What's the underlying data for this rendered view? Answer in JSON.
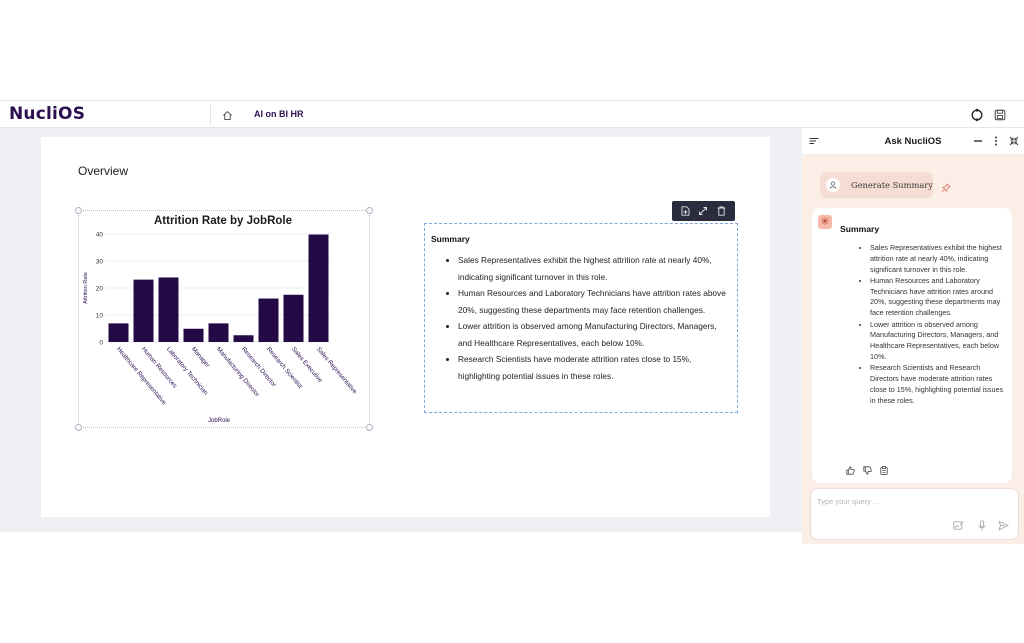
{
  "app": {
    "logo": "NucliOS",
    "breadcrumb": "AI on BI HR"
  },
  "colors": {
    "brand": "#2b0f4f",
    "bar": "#240a45",
    "panel_bg": "#fbeee7",
    "selection": "#7fa9dc"
  },
  "icons": {
    "home": "home-icon",
    "sync": "refresh-icon",
    "save": "save-icon"
  },
  "overview": {
    "title": "Overview"
  },
  "chart_data": {
    "type": "bar",
    "title": "Attrition Rate by JobRole",
    "xlabel": "JobRole",
    "ylabel": "Attrition Rate",
    "ylim": [
      0,
      40
    ],
    "yticks": [
      0,
      10,
      20,
      30,
      40
    ],
    "grid": true,
    "categories": [
      "Healthcare Representative",
      "Human Resources",
      "Laboratory Technician",
      "Manager",
      "Manufacturing Director",
      "Research Director",
      "Research Scientist",
      "Sales Executive",
      "Sales Representative"
    ],
    "values": [
      6.9,
      23.1,
      23.9,
      4.9,
      6.9,
      2.5,
      16.1,
      17.5,
      39.8
    ]
  },
  "summary_card": {
    "title": "Summary",
    "bullets": [
      "Sales Representatives exhibit the highest attrition rate at nearly 40%, indicating significant turnover in this role.",
      "Human Resources and Laboratory Technicians have attrition rates above 20%, suggesting these departments may face retention challenges.",
      "Lower attrition is observed among Manufacturing Directors, Managers, and Healthcare Representatives, each below 10%.",
      "Research Scientists have moderate attrition rates close to 15%, highlighting potential issues in these roles."
    ]
  },
  "ask_panel": {
    "title": "Ask NucliOS",
    "generate_button": "Generate Summary",
    "message": {
      "title": "Summary",
      "bullets": [
        "Sales Representatives exhibit the highest attrition rate at nearly 40%, indicating significant turnover in this role.",
        "Human Resources and Laboratory Technicians have attrition rates around 20%, suggesting these departments may face retention challenges.",
        "Lower attrition is observed among Manufacturing Directors, Managers, and Healthcare Representatives, each below 10%.",
        "Research Scientists and Research Directors have moderate attrition rates close to 15%, highlighting potential issues in these roles."
      ]
    },
    "input": {
      "placeholder": "Type your query ...",
      "value": ""
    }
  }
}
